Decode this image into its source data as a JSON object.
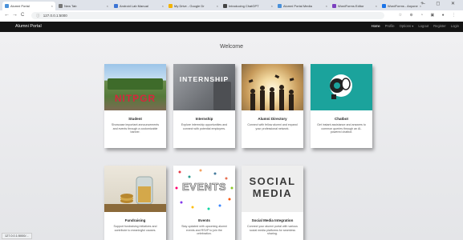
{
  "browser": {
    "tabs": [
      {
        "label": "Alumni Portal",
        "color": "#4a90d9"
      },
      {
        "label": "New Tab",
        "color": "#777777"
      },
      {
        "label": "Android Lab Manual",
        "color": "#3b73d4"
      },
      {
        "label": "My Drive - Google Dr",
        "color": "#f4b400"
      },
      {
        "label": "Introducing ChatGPT",
        "color": "#444444"
      },
      {
        "label": "Alumni Portal Media",
        "color": "#4a90d9"
      },
      {
        "label": "WordForms Editor",
        "color": "#7b3fbf"
      },
      {
        "label": "WordForms - Anyone",
        "color": "#1a73e8"
      }
    ],
    "tab_close": "×",
    "new_tab": "+",
    "window_controls": "– ◻ ✕",
    "back": "←",
    "forward": "→",
    "reload": "C",
    "lock": "ⓘ",
    "url": "127.0.0.1:5000",
    "toolbar_icons": "☆ ⊕ ◔ ▣ ● ⋮"
  },
  "navbar": {
    "brand": "Alumni Portal",
    "links": [
      "Home",
      "Profile",
      "Options ▾",
      "Logout",
      "Register",
      "Login"
    ]
  },
  "main": {
    "heading": "Welcome",
    "cards": [
      {
        "title": "Student",
        "desc": "Showcase important announcements and events through a customizable banner.",
        "banner": "NITPGR"
      },
      {
        "title": "Internship",
        "desc": "Explore internship opportunities and connect with potential employers.",
        "banner": "INTERNSHIP"
      },
      {
        "title": "Alumni Directory",
        "desc": "Connect with fellow alumni and expand your professional network.",
        "banner": ""
      },
      {
        "title": "Chatbot",
        "desc": "Get instant assistance and answers to common queries through an AI-powered chatbot.",
        "banner": ""
      },
      {
        "title": "Fundraising",
        "desc": "Support fundraising initiatives and contribute to meaningful causes.",
        "banner": ""
      },
      {
        "title": "Events",
        "desc": "Stay updated with upcoming alumni events and RSVP to join the celebration.",
        "banner": "EVENTS"
      },
      {
        "title": "Social Media Integration",
        "desc": "Connect your alumni portal with various social media platforms for seamless sharing.",
        "banner": "SOCIAL MEDIA"
      }
    ]
  },
  "status": "127.0.0.1:5000/..."
}
